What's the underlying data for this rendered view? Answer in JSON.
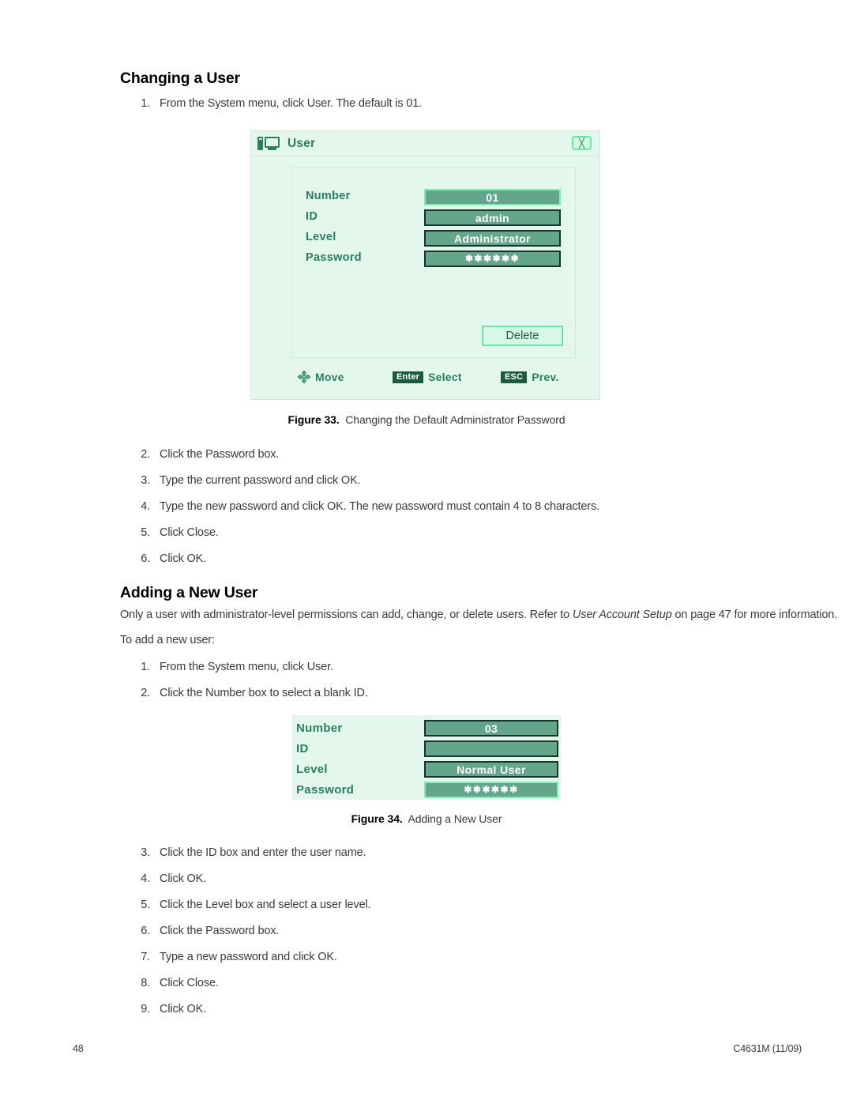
{
  "sections": {
    "changing_user": {
      "heading": "Changing a User",
      "steps": [
        {
          "num": "1.",
          "text": "From the System menu, click User. The default is 01."
        },
        {
          "num": "2.",
          "text": "Click the Password box."
        },
        {
          "num": "3.",
          "text": "Type the current password and click OK."
        },
        {
          "num": "4.",
          "text": "Type the new password and click OK. The new password must contain 4 to 8 characters."
        },
        {
          "num": "5.",
          "text": "Click Close."
        },
        {
          "num": "6.",
          "text": "Click OK."
        }
      ]
    },
    "adding_user": {
      "heading": "Adding a New User",
      "intro_before": "Only a user with administrator-level permissions can add, change, or delete users. Refer to ",
      "intro_italic": "User Account Setup",
      "intro_after": " on page 47 for more information.",
      "lead_in": "To add a new user:",
      "steps": [
        {
          "num": "1.",
          "text": "From the System menu, click User."
        },
        {
          "num": "2.",
          "text": "Click the Number box to select a blank ID."
        },
        {
          "num": "3.",
          "text": "Click the ID box and enter the user name."
        },
        {
          "num": "4.",
          "text": "Click OK."
        },
        {
          "num": "5.",
          "text": "Click the Level box and select a user level."
        },
        {
          "num": "6.",
          "text": "Click the Password box."
        },
        {
          "num": "7.",
          "text": "Type a new password and click OK."
        },
        {
          "num": "8.",
          "text": "Click Close."
        },
        {
          "num": "9.",
          "text": "Click OK."
        }
      ]
    }
  },
  "figure33": {
    "caption_label": "Figure 33.",
    "caption_text": "Changing the Default Administrator Password",
    "dialog": {
      "title": "User",
      "title_icon": "computer-icon",
      "close_icon": "close-icon",
      "fields": [
        {
          "label": "Number",
          "value": "01",
          "selected": true,
          "masked": false
        },
        {
          "label": "ID",
          "value": "admin",
          "selected": false,
          "masked": false
        },
        {
          "label": "Level",
          "value": "Administrator",
          "selected": false,
          "masked": false
        },
        {
          "label": "Password",
          "value": "✱✱✱✱✱✱",
          "selected": false,
          "masked": true
        }
      ],
      "delete_label": "Delete",
      "hints": [
        {
          "icon": "dpad-icon",
          "key": "",
          "label": "Move"
        },
        {
          "icon": "",
          "key": "Enter",
          "label": "Select"
        },
        {
          "icon": "",
          "key": "ESC",
          "label": "Prev."
        }
      ]
    }
  },
  "figure34": {
    "caption_label": "Figure 34.",
    "caption_text": "Adding a New User",
    "fields": [
      {
        "label": "Number",
        "value": "03",
        "selected": false,
        "masked": false
      },
      {
        "label": "ID",
        "value": "",
        "selected": false,
        "masked": false
      },
      {
        "label": "Level",
        "value": "Normal User",
        "selected": false,
        "masked": false
      },
      {
        "label": "Password",
        "value": "✱✱✱✱✱✱",
        "selected": true,
        "masked": true
      }
    ]
  },
  "footer": {
    "page_number": "48",
    "doc_id": "C4631M (11/09)"
  },
  "colors": {
    "panel_bg": "#e3f7ec",
    "field_fill": "#64a68c",
    "field_border": "#16352a",
    "selected_border": "#7df0b4",
    "label_green": "#2a7f60",
    "key_badge": "#1d5b3e"
  }
}
